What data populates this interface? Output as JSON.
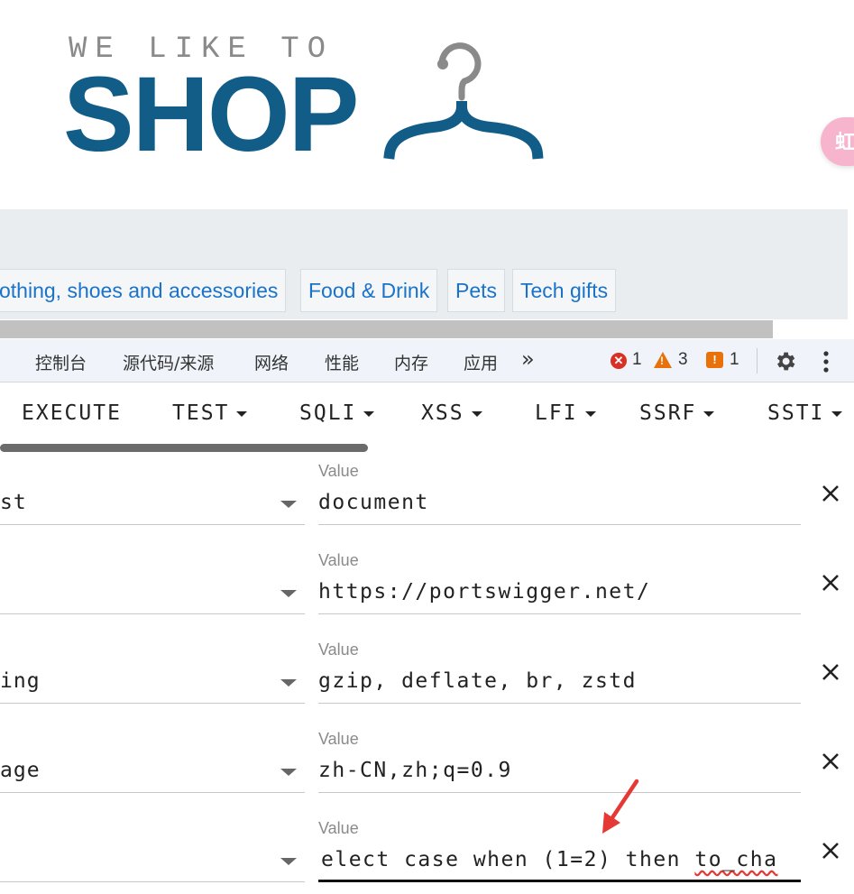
{
  "logo": {
    "tagline": "WE LIKE TO",
    "word": "SHOP"
  },
  "side_badge": "虹",
  "nav": {
    "categories": [
      "othing, shoes and accessories",
      "Food & Drink",
      "Pets",
      "Tech gifts"
    ]
  },
  "devtools": {
    "tabs": [
      "控制台",
      "源代码/来源",
      "网络",
      "性能",
      "内存",
      "应用"
    ],
    "more": "»",
    "error_count": "1",
    "warning_count": "3",
    "issue_count": "1"
  },
  "toolbar": {
    "buttons": [
      "EXECUTE",
      "TEST",
      "SQLI",
      "XSS",
      "LFI",
      "SSRF",
      "SSTI"
    ]
  },
  "value_label": "Value",
  "headers": [
    {
      "name": "st",
      "value": "document"
    },
    {
      "name": "",
      "value": "https://portswigger.net/"
    },
    {
      "name": "ing",
      "value": "gzip, deflate, br, zstd"
    },
    {
      "name": "age",
      "value": "zh-CN,zh;q=0.9"
    },
    {
      "name": "",
      "value_prefix": "elect case when (1=2) then ",
      "value_spell": "to_cha"
    }
  ],
  "colors": {
    "brand": "#115d88",
    "link": "#1a73c8",
    "error": "#d93025",
    "warning": "#e8710a"
  }
}
